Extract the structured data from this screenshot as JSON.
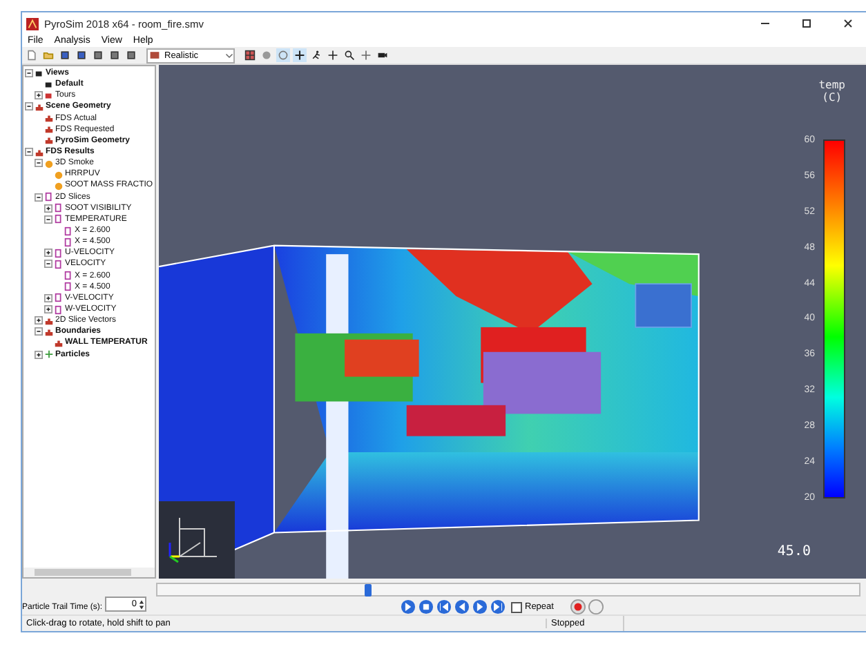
{
  "window": {
    "title": "PyroSim 2018 x64 - room_fire.smv"
  },
  "menu": [
    "File",
    "Analysis",
    "View",
    "Help"
  ],
  "toolbar": {
    "render_mode": "Realistic"
  },
  "tree": [
    {
      "label": "Views",
      "kind": "view",
      "bold": true,
      "expanded": true,
      "children": [
        {
          "label": "Default",
          "kind": "view",
          "bold": true
        },
        {
          "label": "Tours",
          "kind": "tour",
          "bold": false,
          "expanded": false
        }
      ]
    },
    {
      "label": "Scene Geometry",
      "kind": "geometry",
      "bold": true,
      "expanded": true,
      "children": [
        {
          "label": "FDS Actual",
          "kind": "geometry",
          "bold": false
        },
        {
          "label": "FDS Requested",
          "kind": "geometry",
          "bold": false
        },
        {
          "label": "PyroSim Geometry",
          "kind": "geometry",
          "bold": true
        }
      ]
    },
    {
      "label": "FDS Results",
      "kind": "geometry",
      "bold": true,
      "expanded": true,
      "children": [
        {
          "label": "3D Smoke",
          "kind": "smoke",
          "bold": false,
          "expanded": true,
          "children": [
            {
              "label": "HRRPUV",
              "kind": "smoke",
              "bold": false
            },
            {
              "label": "SOOT MASS FRACTIO",
              "kind": "smoke",
              "bold": false
            }
          ]
        },
        {
          "label": "2D Slices",
          "kind": "slice",
          "bold": false,
          "expanded": true,
          "children": [
            {
              "label": "SOOT VISIBILITY",
              "kind": "slice",
              "bold": false,
              "expanded": false
            },
            {
              "label": "TEMPERATURE",
              "kind": "slice",
              "bold": false,
              "expanded": true,
              "children": [
                {
                  "label": "X = 2.600",
                  "kind": "slice",
                  "bold": false
                },
                {
                  "label": "X = 4.500",
                  "kind": "slice",
                  "bold": false
                }
              ]
            },
            {
              "label": "U-VELOCITY",
              "kind": "slice",
              "bold": false,
              "expanded": false
            },
            {
              "label": "VELOCITY",
              "kind": "slice",
              "bold": false,
              "expanded": true,
              "children": [
                {
                  "label": "X = 2.600",
                  "kind": "slice",
                  "bold": false
                },
                {
                  "label": "X = 4.500",
                  "kind": "slice",
                  "bold": false
                }
              ]
            },
            {
              "label": "V-VELOCITY",
              "kind": "slice",
              "bold": false,
              "expanded": false
            },
            {
              "label": "W-VELOCITY",
              "kind": "slice",
              "bold": false,
              "expanded": false
            }
          ]
        },
        {
          "label": "2D Slice Vectors",
          "kind": "geometry",
          "bold": false,
          "expanded": false
        },
        {
          "label": "Boundaries",
          "kind": "geometry",
          "bold": true,
          "expanded": true,
          "children": [
            {
              "label": "WALL TEMPERATUR",
              "kind": "geometry",
              "bold": true
            }
          ]
        },
        {
          "label": "Particles",
          "kind": "particles",
          "bold": true,
          "expanded": false
        }
      ]
    }
  ],
  "legend": {
    "title": "temp\n(C)",
    "ticks": [
      "60",
      "56",
      "52",
      "48",
      "44",
      "40",
      "36",
      "32",
      "28",
      "24",
      "20"
    ]
  },
  "viewport": {
    "time": "45.0"
  },
  "playback": {
    "level": 0.3,
    "trail_label": "Particle Trail Time (s):",
    "trail_value": "0",
    "repeat_label": "Repeat",
    "repeat": false
  },
  "status_bar": {
    "hint": "Click-drag to rotate, hold shift to pan",
    "state": "Stopped"
  }
}
